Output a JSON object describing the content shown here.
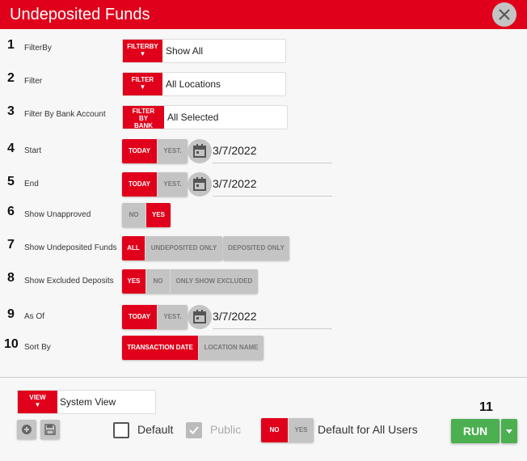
{
  "header": {
    "title": "Undeposited Funds"
  },
  "colors": {
    "accent": "#e0001b",
    "inactive": "#c4c4c4",
    "run": "#4caf50"
  },
  "fields": [
    {
      "num": "1",
      "label": "FilterBy",
      "tag": "FILTERBY",
      "value": "Show All"
    },
    {
      "num": "2",
      "label": "Filter",
      "tag": "FILTER",
      "value": "All Locations"
    },
    {
      "num": "3",
      "label": "Filter By Bank Account",
      "tag_lines": [
        "FILTER",
        "BY",
        "BANK"
      ],
      "value": "All Selected"
    }
  ],
  "start": {
    "num": "4",
    "label": "Start",
    "today": "TODAY",
    "yest": "YEST.",
    "date": "3/7/2022"
  },
  "end": {
    "num": "5",
    "label": "End",
    "today": "TODAY",
    "yest": "YEST.",
    "date": "3/7/2022"
  },
  "show_unapproved": {
    "num": "6",
    "label": "Show Unapproved",
    "options": [
      "NO",
      "YES"
    ],
    "selected": "YES"
  },
  "show_undeposited": {
    "num": "7",
    "label": "Show Undeposited Funds",
    "options": [
      "ALL",
      "UNDEPOSITED ONLY",
      "DEPOSITED ONLY"
    ],
    "selected": "ALL"
  },
  "show_excluded": {
    "num": "8",
    "label": "Show Excluded Deposits",
    "options": [
      "YES",
      "NO",
      "ONLY SHOW EXCLUDED"
    ],
    "selected": "YES"
  },
  "as_of": {
    "num": "9",
    "label": "As Of",
    "today": "TODAY",
    "yest": "YEST.",
    "date": "3/7/2022"
  },
  "sort_by": {
    "num": "10",
    "label": "Sort By",
    "options": [
      "TRANSACTION DATE",
      "LOCATION NAME"
    ],
    "selected": "TRANSACTION DATE"
  },
  "footer": {
    "view_tag": "VIEW",
    "view_value": "System View",
    "default_label": "Default",
    "public_label": "Public",
    "default_all_options": [
      "NO",
      "YES"
    ],
    "default_all_selected": "NO",
    "default_all_label": "Default for All Users",
    "run_num": "11",
    "run_label": "RUN"
  },
  "icons": [
    "close-icon",
    "calendar-icon",
    "chevron-down-icon",
    "add-circle-icon",
    "save-icon",
    "check-icon"
  ]
}
